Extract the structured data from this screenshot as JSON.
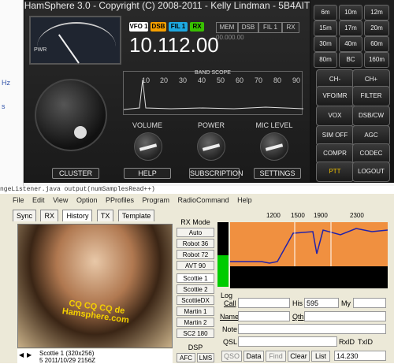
{
  "radio": {
    "title": "HamSphere 3.0 - Copyright (C) 2008-2011 - Kelly Lindman - 5B4AIT",
    "vfo": [
      "VFO 1",
      "DSB",
      "FIL 1",
      "RX"
    ],
    "frequency": "10.112.00",
    "mem_buttons": [
      "MEM",
      "DSB",
      "FIL 1",
      "RX"
    ],
    "mem_readout": "00.000.00",
    "scope_title": "BAND SCOPE",
    "scope_ticks": [
      "10",
      "20",
      "30",
      "40",
      "50",
      "60",
      "70",
      "80",
      "90"
    ],
    "volume_label": "VOLUME",
    "power_label": "POWER",
    "mic_label": "MIC LEVEL",
    "bottom_buttons": [
      "CLUSTER",
      "HELP",
      "SUBSCRIPTION",
      "SETTINGS"
    ],
    "meter_scale": "PWR",
    "band_keys": [
      [
        "6m",
        "10m",
        "12m"
      ],
      [
        "15m",
        "17m",
        "20m"
      ],
      [
        "30m",
        "40m",
        "60m"
      ],
      [
        "80m",
        "BC",
        "160m"
      ]
    ],
    "band_key_extra": "BC",
    "band_key_160": "160m",
    "ch_minus": "CH-",
    "ch_plus": "CH+",
    "func_keys": [
      [
        "VFO/MR",
        "FILTER"
      ],
      [
        "VOX",
        "DSB/CW"
      ],
      [
        "SIM OFF",
        "AGC"
      ],
      [
        "COMPR",
        "CODEC"
      ],
      [
        "PTT",
        "LOGOUT"
      ]
    ]
  },
  "editor_line": "ngeListener.java                                         output(numSamplesRead++)",
  "app": {
    "menu": [
      "File",
      "Edit",
      "View",
      "Option",
      "PProfiles",
      "Program",
      "RadioCommand",
      "Help"
    ],
    "tabs": [
      "Sync",
      "RX",
      "History",
      "TX",
      "Template"
    ],
    "photo_caption": "CQ CQ CQ de Hamsphere.com",
    "photo_nav": "Scottie 1 (320x256)",
    "photo_date": "5 2011/10/29 2156Z",
    "rx_mode_label": "RX Mode",
    "rx_modes": [
      "Auto",
      "Robot 36",
      "Robot 72",
      "AVT 90",
      "Scottie 1",
      "Scottie 2",
      "ScottieDX",
      "Martin 1",
      "Martin 2",
      "SC2 180"
    ],
    "dsp_label": "DSP",
    "dsp_buttons": [
      "AFC",
      "LMS"
    ],
    "wf_ticks": [
      "1200",
      "1500",
      "1900",
      "2300"
    ],
    "log_label": "Log",
    "log_fields": {
      "call": "Call",
      "his": "His",
      "his_val": "595",
      "my": "My",
      "name": "Name",
      "qth": "Qth",
      "note": "Note",
      "qsl": "QSL",
      "rxid": "RxID",
      "txid": "TxID"
    },
    "log_buttons": [
      "QSO",
      "Data",
      "Find",
      "Clear",
      "List"
    ],
    "log_freq": "14.230"
  }
}
